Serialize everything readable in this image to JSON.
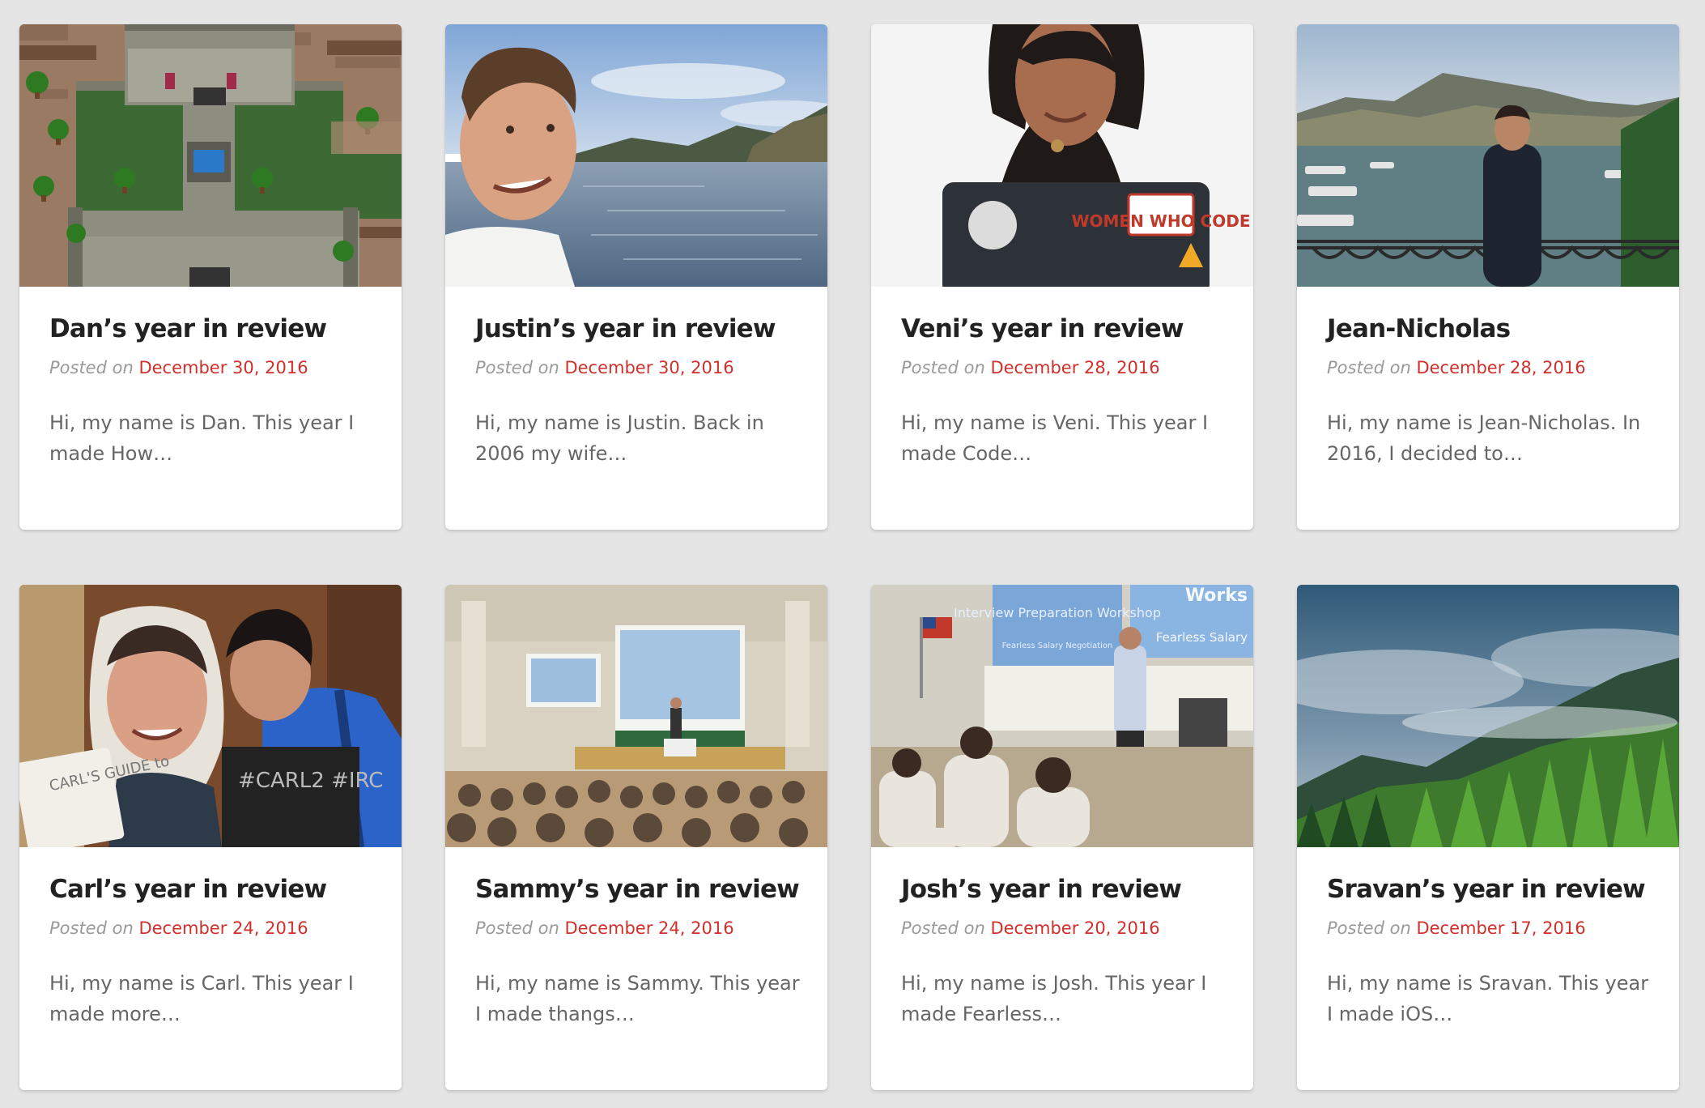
{
  "posted_on_label": "Posted on",
  "posts": [
    {
      "title": "Dan’s year in review",
      "date": "December 30, 2016",
      "excerpt": "Hi, my name is Dan. This year I made How…",
      "image": "pixel-art-castle-game-map"
    },
    {
      "title": "Justin’s year in review",
      "date": "December 30, 2016",
      "excerpt": "Hi, my name is Justin. Back in 2006 my wife…",
      "image": "man-smiling-by-lake"
    },
    {
      "title": "Veni’s year in review",
      "date": "December 28, 2016",
      "excerpt": "Hi, my name is Veni. This year I made Code…",
      "image": "woman-with-laptop-stickers"
    },
    {
      "title": "Jean-Nicholas",
      "date": "December 28, 2016",
      "excerpt": "Hi, my name is Jean-Nicholas. In 2016, I decided to…",
      "image": "man-at-lake-mountains"
    },
    {
      "title": "Carl’s year in review",
      "date": "December 24, 2016",
      "excerpt": "Hi, my name is Carl. This year I made more…",
      "image": "man-with-cardboard-cutout"
    },
    {
      "title": "Sammy’s year in review",
      "date": "December 24, 2016",
      "excerpt": "Hi, my name is Sammy. This year I made thangs…",
      "image": "lecture-hall-presentation"
    },
    {
      "title": "Josh’s year in review",
      "date": "December 20, 2016",
      "excerpt": "Hi, my name is Josh. This year I made Fearless…",
      "image": "classroom-workshop-presenter"
    },
    {
      "title": "Sravan’s year in review",
      "date": "December 17, 2016",
      "excerpt": "Hi, my name is Sravan. This year I made iOS…",
      "image": "misty-forest-mountains"
    }
  ],
  "image_text": {
    "veni_laptop_sticker": "WOMEN WHO CODE",
    "carl_sign": "CARL'S GUIDE to",
    "carl_chalk": "#CARL2 #IRC",
    "josh_slide": "Interview Preparation Workshop",
    "josh_slide_sub": "Fearless Salary Negotiation",
    "josh_slide_right": "Works",
    "josh_slide_right_sub": "Fearless Salary"
  },
  "colors": {
    "background": "#e5e5e5",
    "card": "#ffffff",
    "title": "#222222",
    "posted": "#9a9a9a",
    "date_link": "#d0302b",
    "excerpt": "#666666"
  }
}
